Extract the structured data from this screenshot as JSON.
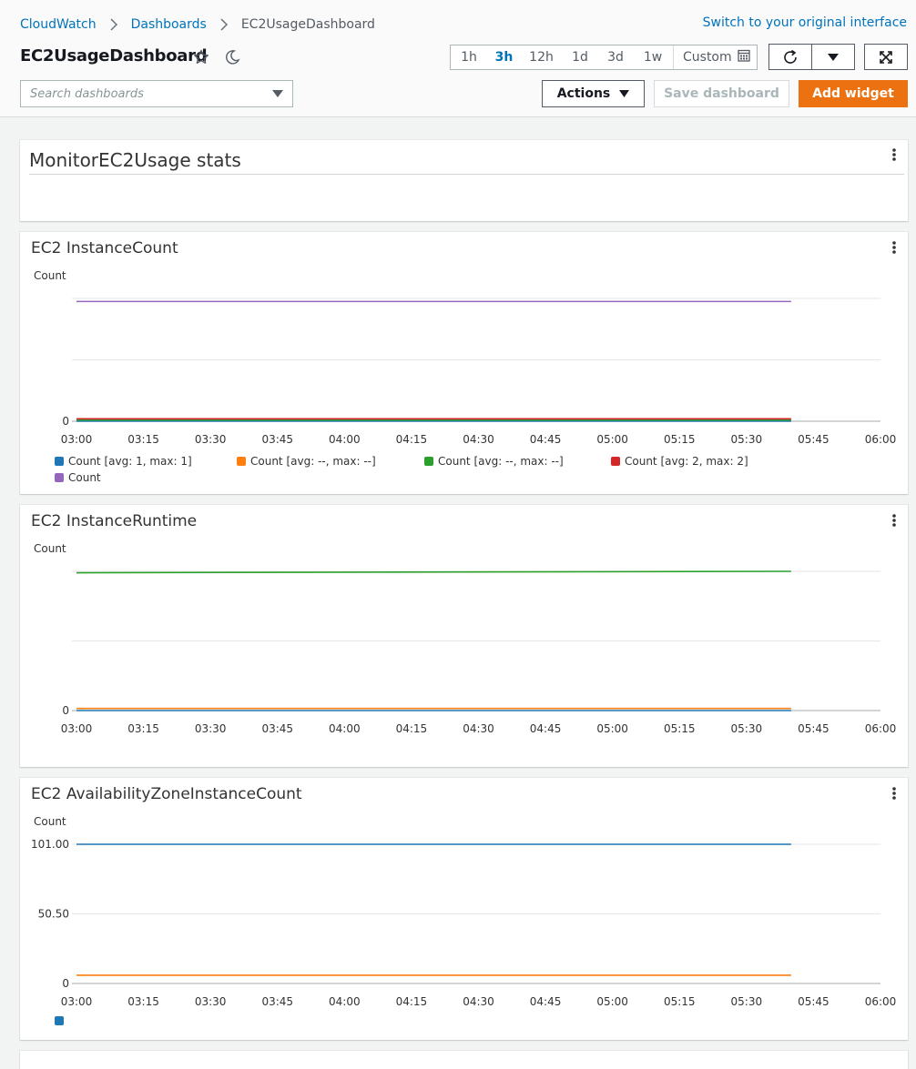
{
  "breadcrumb": {
    "root": "CloudWatch",
    "section": "Dashboards",
    "current": "EC2UsageDashboard"
  },
  "switch_link": "Switch to your original interface",
  "dashboard_title": "EC2UsageDashboard",
  "time_range": {
    "options": [
      "1h",
      "3h",
      "12h",
      "1d",
      "3d",
      "1w"
    ],
    "active": "3h",
    "custom_label": "Custom"
  },
  "search": {
    "placeholder": "Search dashboards"
  },
  "toolbar": {
    "actions_label": "Actions",
    "save_label": "Save dashboard",
    "add_label": "Add widget"
  },
  "text_widget": {
    "title": "MonitorEC2Usage stats"
  },
  "colors": {
    "blue": "#1f77b4",
    "orange": "#ff7f0e",
    "green": "#2ca02c",
    "red": "#d62728",
    "purple": "#9467bd",
    "accent": "#ec7211",
    "link": "#0073bb"
  },
  "chart_data": [
    {
      "type": "line",
      "title": "EC2 InstanceCount",
      "ylabel": "Count",
      "x_ticks": [
        "03:00",
        "03:15",
        "03:30",
        "03:45",
        "04:00",
        "04:15",
        "04:30",
        "04:45",
        "05:00",
        "05:15",
        "05:30",
        "05:45",
        "06:00"
      ],
      "y_ticks": [
        "0"
      ],
      "x_range": [
        "03:00",
        "06:00"
      ],
      "ylim": [
        0,
        2
      ],
      "grid": true,
      "legend_position": "bottom",
      "series": [
        {
          "name": "Count [avg: 1, max: 1]",
          "color": "#1f77b4",
          "x": [
            "03:00",
            "05:40"
          ],
          "y": [
            0.0,
            0.0
          ]
        },
        {
          "name": "Count [avg: --, max: --]",
          "color": "#ff7f0e",
          "x": [
            "03:00",
            "05:40"
          ],
          "y": [
            0.02,
            0.02
          ]
        },
        {
          "name": "Count [avg: --, max: --]",
          "color": "#2ca02c",
          "x": [
            "03:00",
            "05:40"
          ],
          "y": [
            0.02,
            0.02
          ]
        },
        {
          "name": "Count [avg: 2, max: 2]",
          "color": "#d62728",
          "x": [
            "03:00",
            "05:40"
          ],
          "y": [
            0.04,
            0.04
          ]
        },
        {
          "name": "Count",
          "color": "#9467bd",
          "x": [
            "03:00",
            "05:40"
          ],
          "y": [
            1.95,
            1.95
          ]
        }
      ]
    },
    {
      "type": "line",
      "title": "EC2 InstanceRuntime",
      "ylabel": "Count",
      "x_ticks": [
        "03:00",
        "03:15",
        "03:30",
        "03:45",
        "04:00",
        "04:15",
        "04:30",
        "04:45",
        "05:00",
        "05:15",
        "05:30",
        "05:45",
        "06:00"
      ],
      "y_ticks": [
        "0"
      ],
      "x_range": [
        "03:00",
        "06:00"
      ],
      "ylim": [
        0,
        2
      ],
      "grid": true,
      "series": [
        {
          "color": "#1f77b4",
          "x": [
            "03:00",
            "05:40"
          ],
          "y": [
            0.0,
            0.0
          ]
        },
        {
          "color": "#ff7f0e",
          "x": [
            "03:00",
            "05:40"
          ],
          "y": [
            0.03,
            0.03
          ]
        },
        {
          "color": "#2ca02c",
          "x": [
            "03:00",
            "05:40"
          ],
          "y": [
            1.98,
            2.0
          ]
        }
      ]
    },
    {
      "type": "line",
      "title": "EC2 AvailabilityZoneInstanceCount",
      "ylabel": "Count",
      "x_ticks": [
        "03:00",
        "03:15",
        "03:30",
        "03:45",
        "04:00",
        "04:15",
        "04:30",
        "04:45",
        "05:00",
        "05:15",
        "05:30",
        "05:45",
        "06:00"
      ],
      "y_ticks": [
        "0",
        "50.50",
        "101.00"
      ],
      "x_range": [
        "03:00",
        "06:00"
      ],
      "ylim": [
        0,
        101
      ],
      "grid": true,
      "legend_position": "bottom",
      "series": [
        {
          "color": "#1f77b4",
          "x": [
            "03:00",
            "05:40"
          ],
          "y": [
            101,
            101
          ]
        },
        {
          "color": "#ff7f0e",
          "x": [
            "03:00",
            "05:40"
          ],
          "y": [
            6,
            6
          ]
        }
      ]
    }
  ]
}
